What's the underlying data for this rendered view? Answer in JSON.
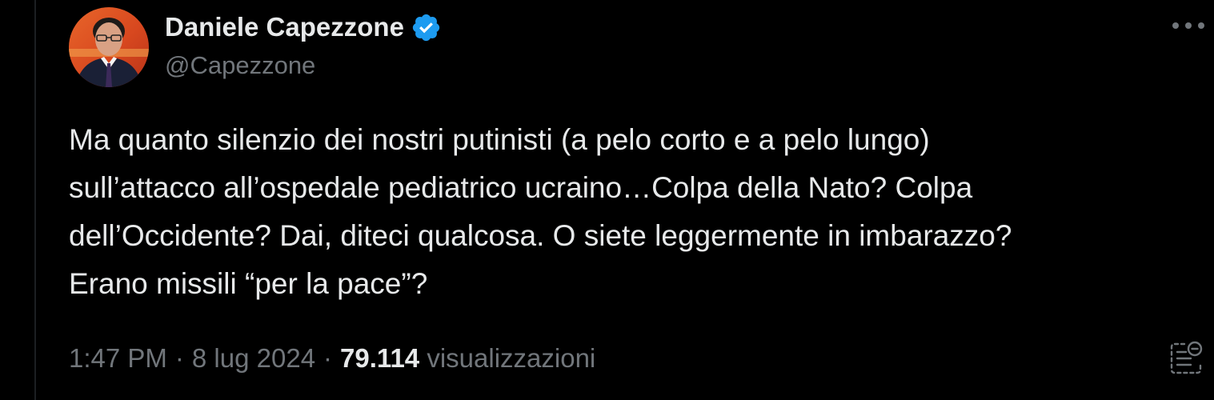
{
  "author": {
    "display_name": "Daniele Capezzone",
    "handle": "@Capezzone",
    "verified": true
  },
  "tweet": {
    "text_lines": [
      "Ma quanto silenzio dei nostri putinisti (a pelo corto e a pelo lungo)",
      "sull’attacco all’ospedale pediatrico ucraino…Colpa della Nato? Colpa",
      "dell’Occidente? Dai, diteci qualcosa. O siete leggermente in imbarazzo?",
      "Erano missili “per la pace”?"
    ]
  },
  "meta": {
    "time": "1:47 PM",
    "separator": "·",
    "date": "8 lug 2024",
    "views_count": "79.114",
    "views_label": "visualizzazioni"
  },
  "icons": {
    "more": "more-options-icon",
    "verified": "verified-badge-icon",
    "analytics": "post-analytics-icon"
  },
  "colors": {
    "background": "#000000",
    "primary_text": "#e7e9ea",
    "secondary_text": "#71767b",
    "verified_blue": "#1d9bf0"
  }
}
